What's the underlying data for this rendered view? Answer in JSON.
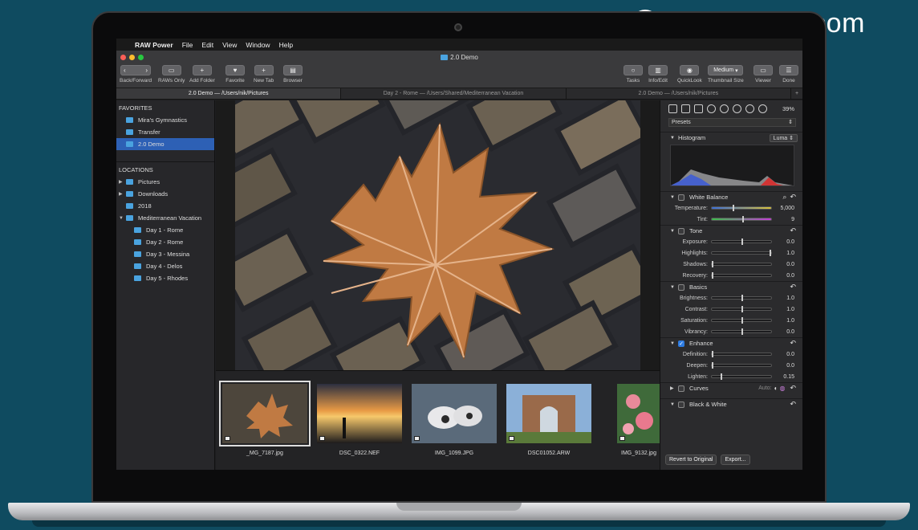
{
  "watermark": {
    "logo_letter": "Z",
    "text": "www.MacZ.com"
  },
  "menubar": {
    "apple": "",
    "app": "RAW Power",
    "items": [
      "File",
      "Edit",
      "View",
      "Window",
      "Help"
    ]
  },
  "window": {
    "title": "2.0 Demo"
  },
  "toolbar": {
    "back_forward": "Back/Forward",
    "raws_only": "RAWs Only",
    "add_folder": "Add Folder",
    "favorite": "Favorite",
    "new_tab": "New Tab",
    "browser": "Browser",
    "tasks": "Tasks",
    "info_edit": "Info/Edit",
    "quicklook": "QuickLook",
    "thumbnail_size": "Thumbnail Size",
    "thumbnail_size_value": "Medium",
    "viewer": "Viewer",
    "done": "Done"
  },
  "tabs": [
    {
      "label": "2.0 Demo  —  /Users/nik/Pictures",
      "active": true
    },
    {
      "label": "Day 2 - Rome  —  /Users/Shared/Mediterranean Vacation",
      "active": false
    },
    {
      "label": "2.0 Demo  —  /Users/nik/Pictures",
      "active": false
    }
  ],
  "tab_add": "+",
  "sidebar": {
    "favorites_header": "FAVORITES",
    "favorites": [
      "Mira's Gymnastics",
      "Transfer",
      "2.0 Demo"
    ],
    "locations_header": "LOCATIONS",
    "locations": [
      "Pictures",
      "Downloads",
      "2018",
      "Mediterranean Vacation"
    ],
    "vacation_children": [
      "Day 1 - Rome",
      "Day 2 - Rome",
      "Day 3 - Messina",
      "Day 4 - Delos",
      "Day 5 - Rhodes"
    ]
  },
  "thumbnails": [
    "_MG_7187.jpg",
    "DSC_0322.NEF",
    "IMG_1099.JPG",
    "DSC01052.ARW",
    "IMG_9132.jpg"
  ],
  "inspector": {
    "zoom": "39%",
    "presets": "Presets",
    "histogram": {
      "label": "Histogram",
      "mode": "Luma"
    },
    "white_balance": {
      "label": "White Balance",
      "rows": [
        {
          "label": "Temperature:",
          "value": "5,000"
        },
        {
          "label": "Tint:",
          "value": "9"
        }
      ]
    },
    "tone": {
      "label": "Tone",
      "rows": [
        {
          "label": "Exposure:",
          "value": "0.0"
        },
        {
          "label": "Highlights:",
          "value": "1.0"
        },
        {
          "label": "Shadows:",
          "value": "0.0"
        },
        {
          "label": "Recovery:",
          "value": "0.0"
        }
      ]
    },
    "basics": {
      "label": "Basics",
      "rows": [
        {
          "label": "Brightness:",
          "value": "1.0"
        },
        {
          "label": "Contrast:",
          "value": "1.0"
        },
        {
          "label": "Saturation:",
          "value": "1.0"
        },
        {
          "label": "Vibrancy:",
          "value": "0.0"
        }
      ]
    },
    "enhance": {
      "label": "Enhance",
      "rows": [
        {
          "label": "Definition:",
          "value": "0.0"
        },
        {
          "label": "Deepen:",
          "value": "0.0"
        },
        {
          "label": "Lighten:",
          "value": "0.15"
        }
      ]
    },
    "curves": {
      "label": "Curves",
      "auto": "Auto:"
    },
    "black_white": {
      "label": "Black & White"
    },
    "revert": "Revert to Original",
    "export": "Export..."
  },
  "colors": {
    "accent": "#2d60b5",
    "folder": "#4aa3df",
    "background": "#0f4b60"
  }
}
